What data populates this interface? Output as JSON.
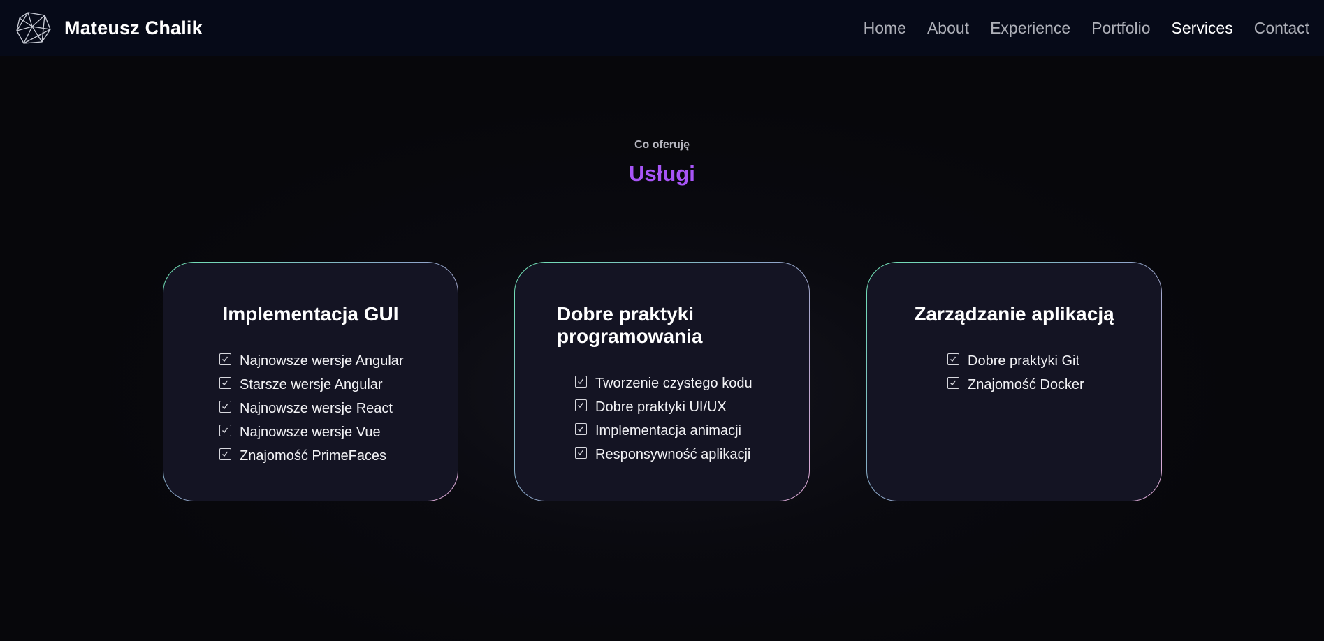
{
  "nav": {
    "brand_name": "Mateusz Chalik",
    "logo_icon": "polyhedron-logo-icon",
    "links": [
      {
        "label": "Home",
        "active": false
      },
      {
        "label": "About",
        "active": false
      },
      {
        "label": "Experience",
        "active": false
      },
      {
        "label": "Portfolio",
        "active": false
      },
      {
        "label": "Services",
        "active": true
      },
      {
        "label": "Contact",
        "active": false
      }
    ]
  },
  "section": {
    "subtitle": "Co oferuję",
    "title": "Usługi"
  },
  "cards": [
    {
      "title": "Implementacja GUI",
      "items": [
        "Najnowsze wersje Angular",
        "Starsze wersje Angular",
        "Najnowsze wersje React",
        "Najnowsze wersje Vue",
        "Znajomość PrimeFaces"
      ]
    },
    {
      "title": "Dobre praktyki programowania",
      "items": [
        "Tworzenie czystego kodu",
        "Dobre praktyki UI/UX",
        "Implementacja animacji",
        "Responsywność aplikacji"
      ]
    },
    {
      "title": "Zarządzanie aplikacją",
      "items": [
        "Dobre praktyki Git",
        "Znajomość Docker"
      ]
    }
  ],
  "colors": {
    "accent": "#a855f7",
    "nav_bg": "#060a18",
    "page_bg": "#07070b",
    "card_bg": "#141423",
    "card_border_start": "#6fe3b4",
    "card_border_end": "#e0a9d6"
  },
  "icons": {
    "list_item": "checkbox-checked-icon"
  }
}
